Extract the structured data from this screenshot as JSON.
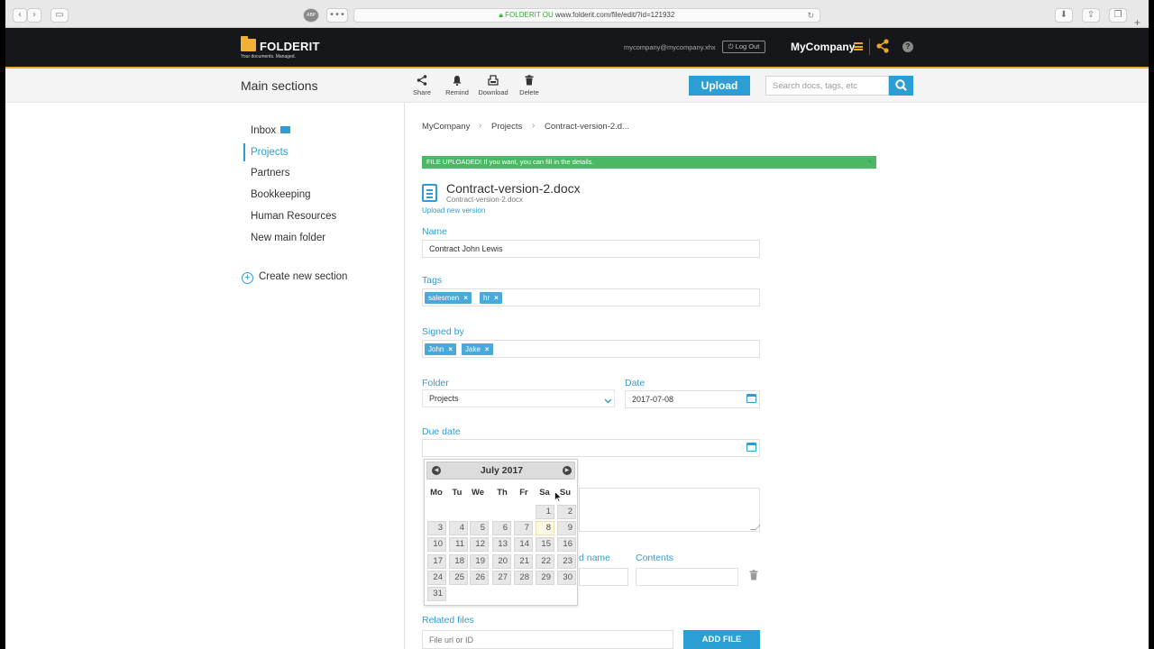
{
  "browser": {
    "url_org": "FOLDERIT OU",
    "url": "www.folderit.com/file/edit/?id=121932",
    "abp": "ABP"
  },
  "header": {
    "logo_text": "FOLDERIT",
    "logo_tagline": "Your documents. Managed.",
    "user_email": "mycompany@mycompany.xhx",
    "logout_label": "Log Out",
    "company": "MyCompany"
  },
  "toolbar": {
    "section_title": "Main sections",
    "share": "Share",
    "remind": "Remind",
    "download": "Download",
    "delete": "Delete",
    "upload": "Upload",
    "search_placeholder": "Search docs, tags, etc"
  },
  "sidebar": {
    "items": [
      {
        "label": "Inbox"
      },
      {
        "label": "Projects"
      },
      {
        "label": "Partners"
      },
      {
        "label": "Bookkeeping"
      },
      {
        "label": "Human Resources"
      },
      {
        "label": "New main folder"
      }
    ],
    "create_section": "Create new section"
  },
  "breadcrumb": [
    "MyCompany",
    "Projects",
    "Contract-version-2.d..."
  ],
  "alert": {
    "text": "FILE UPLOADED! If you want, you can fill in the details.",
    "close": "×"
  },
  "document": {
    "title": "Contract-version-2.docx",
    "filename": "Contract-version-2.docx",
    "upload_new_version": "Upload new version"
  },
  "form": {
    "name_label": "Name",
    "name_value": "Contract John Lewis",
    "tags_label": "Tags",
    "tags": [
      "salesmen",
      "hr"
    ],
    "signed_label": "Signed by",
    "signed": [
      "John",
      "Jake"
    ],
    "folder_label": "Folder",
    "folder_value": "Projects",
    "date_label": "Date",
    "date_value": "2017-07-08",
    "due_label": "Due date",
    "due_value": "",
    "field_name_label": "d name",
    "contents_label": "Contents",
    "related_label": "Related files",
    "related_placeholder": "File url or ID",
    "add_file": "ADD FILE"
  },
  "datepicker": {
    "title": "July 2017",
    "days_of_week": [
      "Mo",
      "Tu",
      "We",
      "Th",
      "Fr",
      "Sa",
      "Su"
    ],
    "weeks": [
      [
        "",
        "",
        "",
        "",
        "",
        "1",
        "2"
      ],
      [
        "3",
        "4",
        "5",
        "6",
        "7",
        "8",
        "9"
      ],
      [
        "10",
        "11",
        "12",
        "13",
        "14",
        "15",
        "16"
      ],
      [
        "17",
        "18",
        "19",
        "20",
        "21",
        "22",
        "23"
      ],
      [
        "24",
        "25",
        "26",
        "27",
        "28",
        "29",
        "30"
      ],
      [
        "31",
        "",
        "",
        "",
        "",
        "",
        ""
      ]
    ],
    "highlighted": "8"
  },
  "colors": {
    "accent": "#2b9ed4",
    "header_bg": "#16171a",
    "brand_yellow": "#f2b134",
    "success": "#4cb765"
  }
}
